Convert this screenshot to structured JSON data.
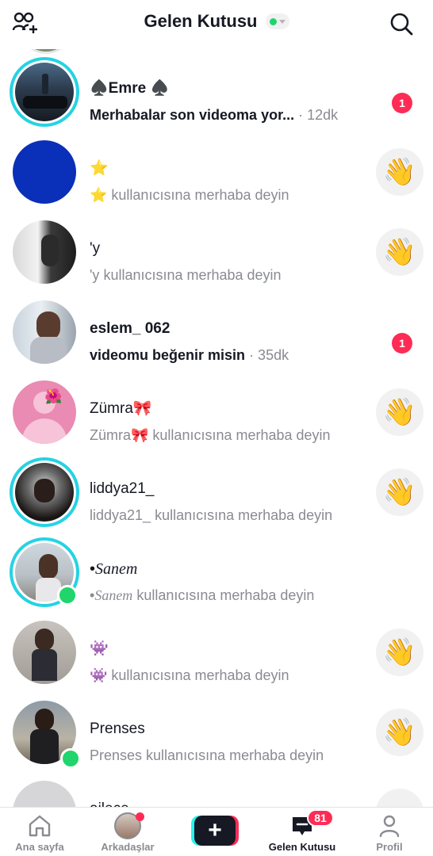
{
  "header": {
    "title": "Gelen Kutusu",
    "left_icon": "add-friends-icon",
    "right_icon": "search-icon",
    "status_color": "#20d56c"
  },
  "conversations": [
    {
      "name": "♠️Emre ♠️",
      "subtitle": "Merhabalar son videoma yor...",
      "time": "· 12dk",
      "unread": "1",
      "bold": true,
      "ring": true,
      "online": false,
      "action": "unread"
    },
    {
      "name": "⭐",
      "subtitle": "⭐ kullanıcısına merhaba deyin",
      "time": "",
      "unread": "",
      "bold": false,
      "ring": false,
      "online": false,
      "action": "wave"
    },
    {
      "name": "'y",
      "subtitle": "'y kullanıcısına merhaba deyin",
      "time": "",
      "unread": "",
      "bold": false,
      "ring": false,
      "online": false,
      "action": "wave"
    },
    {
      "name": "eslem_ 062",
      "subtitle": "videomu beğenir misin",
      "time": "· 35dk",
      "unread": "1",
      "bold": true,
      "ring": false,
      "online": false,
      "action": "unread"
    },
    {
      "name": "Zümra🎀",
      "subtitle": "Zümra🎀 kullanıcısına merhaba deyin",
      "time": "",
      "unread": "",
      "bold": false,
      "ring": false,
      "online": false,
      "action": "wave"
    },
    {
      "name": "liddya21_",
      "subtitle": "liddya21_ kullanıcısına merhaba deyin",
      "time": "",
      "unread": "",
      "bold": false,
      "ring": true,
      "online": false,
      "action": "wave"
    },
    {
      "name_prefix": "•",
      "name_styled": "Sanem",
      "sub_prefix": "•",
      "sub_styled": "Sanem",
      "sub_suffix": " kullanıcısına merhaba deyin",
      "bold": false,
      "ring": true,
      "online": true,
      "action": "none"
    },
    {
      "name": "👾",
      "subtitle": "👾 kullanıcısına merhaba deyin",
      "time": "",
      "unread": "",
      "bold": false,
      "ring": false,
      "online": false,
      "action": "wave"
    },
    {
      "name": "Prenses",
      "subtitle": "Prenses kullanıcısına merhaba deyin",
      "time": "",
      "unread": "",
      "bold": false,
      "ring": false,
      "online": true,
      "action": "wave"
    },
    {
      "name": "ailece",
      "subtitle": "",
      "time": "",
      "unread": "",
      "bold": false,
      "ring": false,
      "online": false,
      "action": "wave"
    }
  ],
  "wave_emoji": "👋",
  "nav": {
    "home": "Ana sayfa",
    "friends": "Arkadaşlar",
    "inbox": "Gelen Kutusu",
    "profile": "Profil",
    "inbox_badge": "81",
    "plus": "+"
  },
  "colors": {
    "accent_red": "#fe2c55",
    "ring_cyan": "#25d3e3",
    "online_green": "#20d56c"
  }
}
